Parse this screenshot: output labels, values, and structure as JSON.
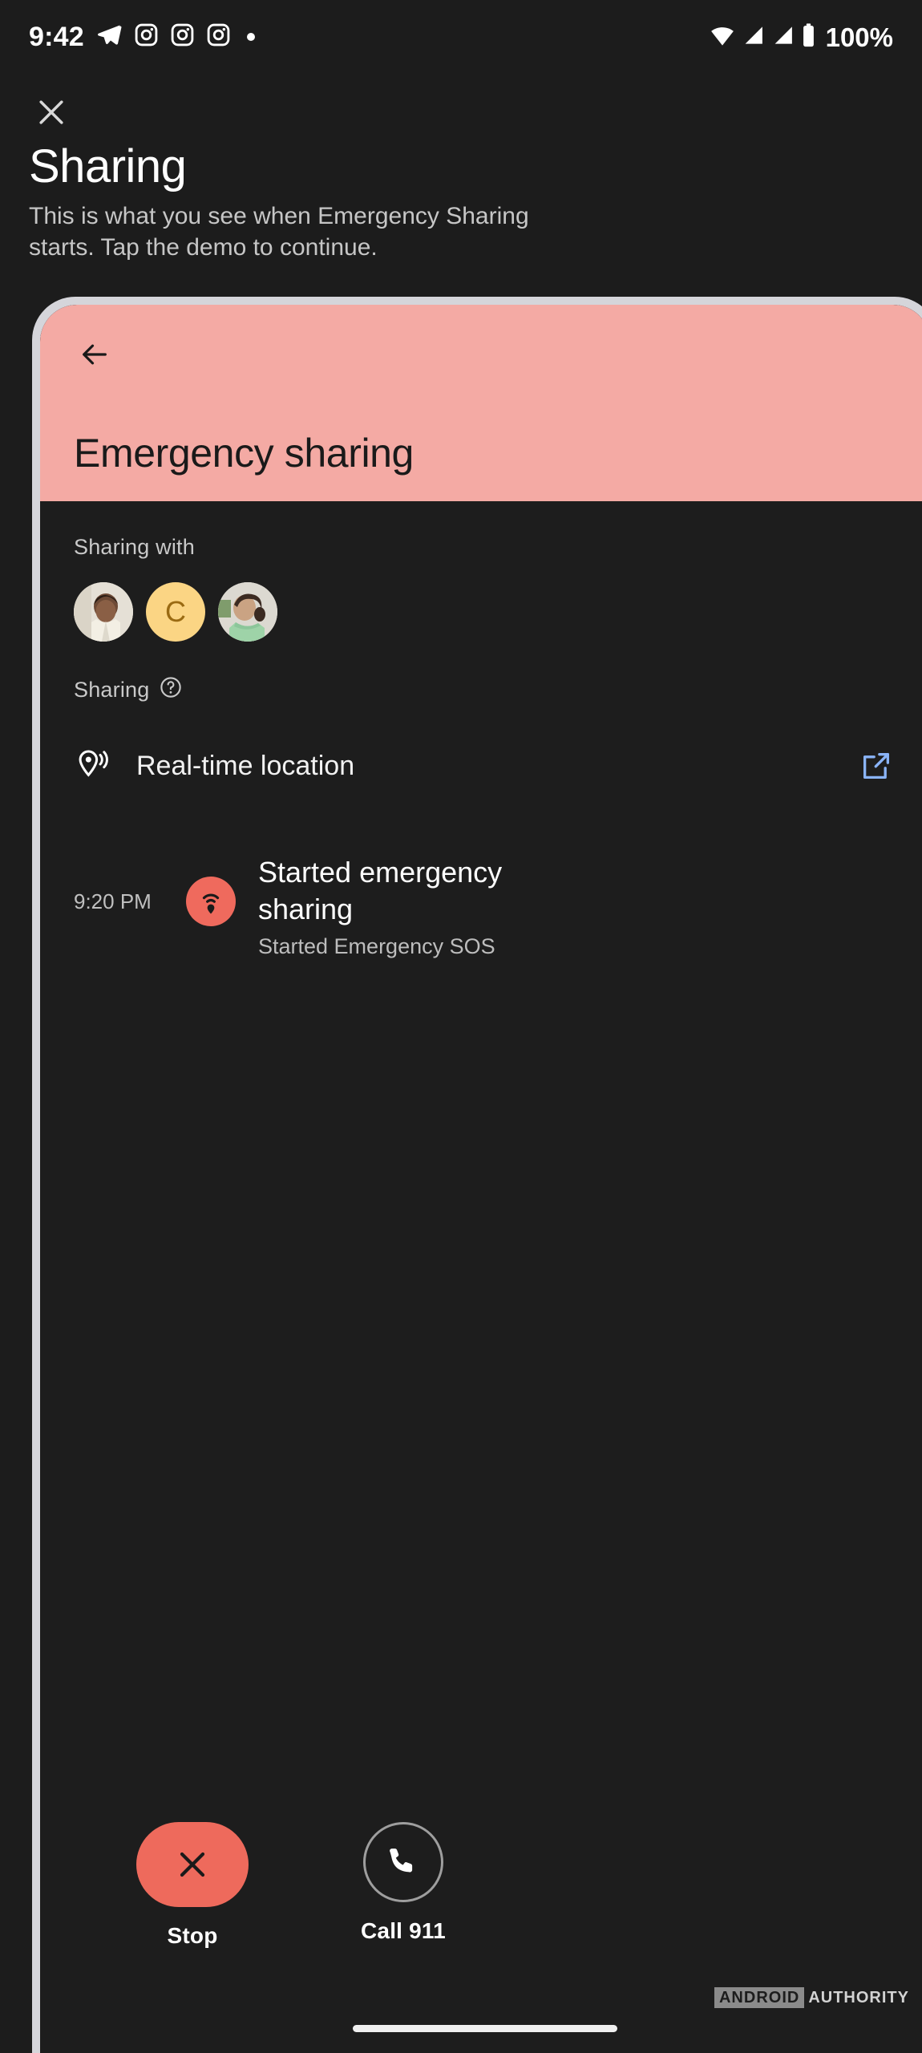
{
  "status_bar": {
    "time": "9:42",
    "battery_percent": "100%",
    "icons": [
      "telegram-icon",
      "instagram-icon",
      "instagram-icon",
      "instagram-icon",
      "notification-dot-icon",
      "wifi-icon",
      "signal-icon",
      "signal-icon",
      "battery-icon"
    ]
  },
  "header": {
    "close_icon": "close-icon",
    "title": "Sharing",
    "description": "This is what you see when Emergency Sharing starts. Tap the demo to continue."
  },
  "demo": {
    "hero": {
      "back_icon": "back-arrow-icon",
      "title": "Emergency sharing",
      "background_color": "#f4aaa4"
    },
    "sharing_with": {
      "label": "Sharing with",
      "contacts": [
        {
          "type": "photo",
          "name": "contact-avatar-1"
        },
        {
          "type": "initial",
          "initial": "C",
          "bg": "#fbd584",
          "fg": "#9a6a12"
        },
        {
          "type": "photo",
          "name": "contact-avatar-3"
        }
      ]
    },
    "sharing_section": {
      "label": "Sharing",
      "help_icon": "help-circle-icon",
      "rows": [
        {
          "icon": "location-broadcast-icon",
          "label": "Real-time location",
          "action_icon": "open-in-new-icon",
          "action_color": "#8ab4f8"
        }
      ]
    },
    "timeline": [
      {
        "time": "9:20 PM",
        "badge_icon": "location-broadcast-icon",
        "badge_color": "#ef6a5d",
        "title": "Started emergency sharing",
        "subtitle": "Started Emergency SOS"
      }
    ],
    "actions": [
      {
        "icon": "close-icon",
        "label": "Stop",
        "style": "filled",
        "color": "#ee6a5c"
      },
      {
        "icon": "phone-icon",
        "label": "Call 911",
        "style": "outlined",
        "color": "#9e9e9e"
      }
    ]
  },
  "watermark": {
    "brand": "ANDROID",
    "suffix": "AUTHORITY"
  }
}
